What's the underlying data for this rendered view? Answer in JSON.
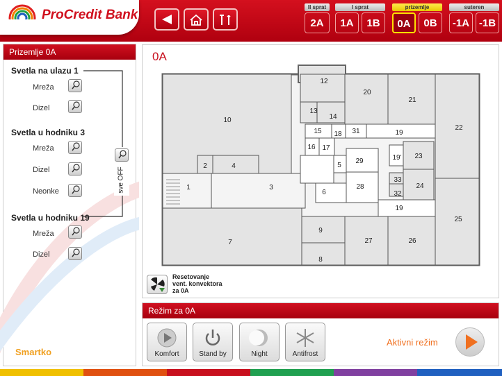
{
  "header": {
    "brand": "ProCredit Bank",
    "nav_icons": [
      "back-arrow-icon",
      "house-icon",
      "tools-icon"
    ],
    "floor_groups": [
      {
        "label": "II sprat",
        "floors": [
          "2A"
        ]
      },
      {
        "label": "I sprat",
        "floors": [
          "1A",
          "1B"
        ]
      },
      {
        "label": "prizemlje",
        "floors": [
          "0A",
          "0B"
        ],
        "active": true
      },
      {
        "label": "suteren",
        "floors": [
          "-1A",
          "-1B"
        ]
      }
    ],
    "selected_floor": "0A"
  },
  "sidebar": {
    "title": "Prizemlje 0A",
    "groups": [
      {
        "title": "Svetla na ulazu 1",
        "rows": [
          "Mreža",
          "Dizel"
        ]
      },
      {
        "title": "Svetla u hodniku 3",
        "rows": [
          "Mreža",
          "Dizel",
          "Neonke"
        ]
      },
      {
        "title": "Svetla u hodniku 19",
        "rows": [
          "Mreža",
          "Dizel"
        ]
      }
    ],
    "all_off_label": "sve OFF",
    "brand_footer": "Smartko"
  },
  "plan": {
    "title": "0A",
    "reset_text": [
      "Resetovanje",
      "vent. konvektora",
      "za 0A"
    ],
    "rooms": [
      "1",
      "2",
      "3",
      "4",
      "5",
      "6",
      "7",
      "8",
      "9",
      "10",
      "12",
      "13",
      "14",
      "15",
      "16",
      "17",
      "18",
      "19",
      "19'",
      "20",
      "21",
      "22",
      "23",
      "24",
      "25",
      "26",
      "27",
      "28",
      "29",
      "31",
      "32",
      "33"
    ]
  },
  "mode": {
    "title": "Režim za 0A",
    "buttons": [
      "Komfort",
      "Stand by",
      "Night",
      "Antifrost"
    ],
    "active_label": "Aktivni režim"
  },
  "colors": {
    "brand_red": "#c8101e",
    "room_fill": "#e4e4e4",
    "active_floor": "#ffe000",
    "arrow_orange": "#f07020"
  }
}
